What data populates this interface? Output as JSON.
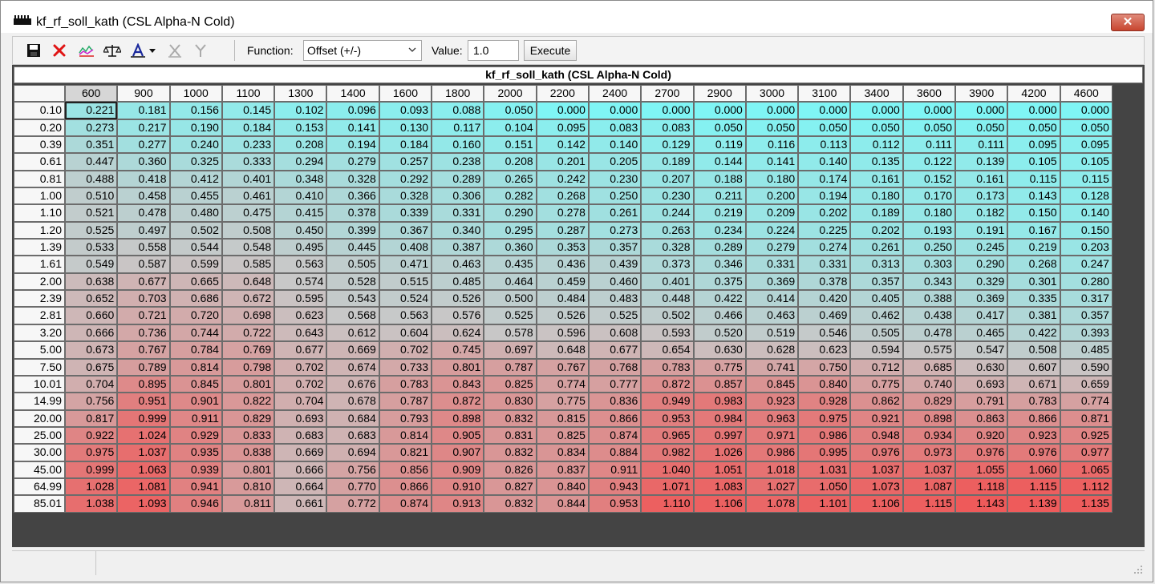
{
  "window": {
    "title": "kf_rf_soll_kath (CSL Alpha-N Cold)",
    "close_label": "✕"
  },
  "toolbar": {
    "function_label": "Function:",
    "function_value": "Offset (+/-)",
    "value_label": "Value:",
    "value_value": "1.0",
    "execute_label": "Execute"
  },
  "map": {
    "title": "kf_rf_soll_kath (CSL Alpha-N Cold)",
    "columns": [
      "600",
      "900",
      "1000",
      "1100",
      "1300",
      "1400",
      "1600",
      "1800",
      "2000",
      "2200",
      "2400",
      "2700",
      "2900",
      "3000",
      "3100",
      "3400",
      "3600",
      "3900",
      "4200",
      "4600"
    ],
    "rows": [
      {
        "label": "0.10",
        "values": [
          "0.221",
          "0.181",
          "0.156",
          "0.145",
          "0.102",
          "0.096",
          "0.093",
          "0.088",
          "0.050",
          "0.000",
          "0.000",
          "0.000",
          "0.000",
          "0.000",
          "0.000",
          "0.000",
          "0.000",
          "0.000",
          "0.000",
          "0.000"
        ]
      },
      {
        "label": "0.20",
        "values": [
          "0.273",
          "0.217",
          "0.190",
          "0.184",
          "0.153",
          "0.141",
          "0.130",
          "0.117",
          "0.104",
          "0.095",
          "0.083",
          "0.083",
          "0.050",
          "0.050",
          "0.050",
          "0.050",
          "0.050",
          "0.050",
          "0.050",
          "0.050"
        ]
      },
      {
        "label": "0.39",
        "values": [
          "0.351",
          "0.277",
          "0.240",
          "0.233",
          "0.208",
          "0.194",
          "0.184",
          "0.160",
          "0.151",
          "0.142",
          "0.140",
          "0.129",
          "0.119",
          "0.116",
          "0.113",
          "0.112",
          "0.111",
          "0.111",
          "0.095",
          "0.095"
        ]
      },
      {
        "label": "0.61",
        "values": [
          "0.447",
          "0.360",
          "0.325",
          "0.333",
          "0.294",
          "0.279",
          "0.257",
          "0.238",
          "0.208",
          "0.201",
          "0.205",
          "0.189",
          "0.144",
          "0.141",
          "0.140",
          "0.135",
          "0.122",
          "0.139",
          "0.105",
          "0.105"
        ]
      },
      {
        "label": "0.81",
        "values": [
          "0.488",
          "0.418",
          "0.412",
          "0.401",
          "0.348",
          "0.328",
          "0.292",
          "0.289",
          "0.265",
          "0.242",
          "0.230",
          "0.207",
          "0.188",
          "0.180",
          "0.174",
          "0.161",
          "0.152",
          "0.161",
          "0.115",
          "0.115"
        ]
      },
      {
        "label": "1.00",
        "values": [
          "0.510",
          "0.458",
          "0.455",
          "0.461",
          "0.410",
          "0.366",
          "0.328",
          "0.306",
          "0.282",
          "0.268",
          "0.250",
          "0.230",
          "0.211",
          "0.200",
          "0.194",
          "0.180",
          "0.170",
          "0.173",
          "0.143",
          "0.128"
        ]
      },
      {
        "label": "1.10",
        "values": [
          "0.521",
          "0.478",
          "0.480",
          "0.475",
          "0.415",
          "0.378",
          "0.339",
          "0.331",
          "0.290",
          "0.278",
          "0.261",
          "0.244",
          "0.219",
          "0.209",
          "0.202",
          "0.189",
          "0.180",
          "0.182",
          "0.150",
          "0.140"
        ]
      },
      {
        "label": "1.20",
        "values": [
          "0.525",
          "0.497",
          "0.502",
          "0.508",
          "0.450",
          "0.399",
          "0.367",
          "0.340",
          "0.295",
          "0.287",
          "0.273",
          "0.263",
          "0.234",
          "0.224",
          "0.225",
          "0.202",
          "0.193",
          "0.191",
          "0.167",
          "0.150"
        ]
      },
      {
        "label": "1.39",
        "values": [
          "0.533",
          "0.558",
          "0.544",
          "0.548",
          "0.495",
          "0.445",
          "0.408",
          "0.387",
          "0.360",
          "0.353",
          "0.357",
          "0.328",
          "0.289",
          "0.279",
          "0.274",
          "0.261",
          "0.250",
          "0.245",
          "0.219",
          "0.203"
        ]
      },
      {
        "label": "1.61",
        "values": [
          "0.549",
          "0.587",
          "0.599",
          "0.585",
          "0.563",
          "0.505",
          "0.471",
          "0.463",
          "0.435",
          "0.436",
          "0.439",
          "0.373",
          "0.346",
          "0.331",
          "0.331",
          "0.313",
          "0.303",
          "0.290",
          "0.268",
          "0.247"
        ]
      },
      {
        "label": "2.00",
        "values": [
          "0.638",
          "0.677",
          "0.665",
          "0.648",
          "0.574",
          "0.528",
          "0.515",
          "0.485",
          "0.464",
          "0.459",
          "0.460",
          "0.401",
          "0.375",
          "0.369",
          "0.378",
          "0.357",
          "0.343",
          "0.329",
          "0.301",
          "0.280"
        ]
      },
      {
        "label": "2.39",
        "values": [
          "0.652",
          "0.703",
          "0.686",
          "0.672",
          "0.595",
          "0.543",
          "0.524",
          "0.526",
          "0.500",
          "0.484",
          "0.483",
          "0.448",
          "0.422",
          "0.414",
          "0.420",
          "0.405",
          "0.388",
          "0.369",
          "0.335",
          "0.317"
        ]
      },
      {
        "label": "2.81",
        "values": [
          "0.660",
          "0.721",
          "0.720",
          "0.698",
          "0.623",
          "0.568",
          "0.563",
          "0.576",
          "0.525",
          "0.526",
          "0.525",
          "0.502",
          "0.466",
          "0.463",
          "0.469",
          "0.462",
          "0.438",
          "0.417",
          "0.381",
          "0.357"
        ]
      },
      {
        "label": "3.20",
        "values": [
          "0.666",
          "0.736",
          "0.744",
          "0.722",
          "0.643",
          "0.612",
          "0.604",
          "0.624",
          "0.578",
          "0.596",
          "0.608",
          "0.593",
          "0.520",
          "0.519",
          "0.546",
          "0.505",
          "0.478",
          "0.465",
          "0.422",
          "0.393"
        ]
      },
      {
        "label": "5.00",
        "values": [
          "0.673",
          "0.767",
          "0.784",
          "0.769",
          "0.677",
          "0.669",
          "0.702",
          "0.745",
          "0.697",
          "0.648",
          "0.677",
          "0.654",
          "0.630",
          "0.628",
          "0.623",
          "0.594",
          "0.575",
          "0.547",
          "0.508",
          "0.485"
        ]
      },
      {
        "label": "7.50",
        "values": [
          "0.675",
          "0.789",
          "0.814",
          "0.798",
          "0.702",
          "0.674",
          "0.733",
          "0.801",
          "0.787",
          "0.767",
          "0.768",
          "0.783",
          "0.775",
          "0.741",
          "0.750",
          "0.712",
          "0.685",
          "0.630",
          "0.607",
          "0.590"
        ]
      },
      {
        "label": "10.01",
        "values": [
          "0.704",
          "0.895",
          "0.845",
          "0.801",
          "0.702",
          "0.676",
          "0.783",
          "0.843",
          "0.825",
          "0.774",
          "0.777",
          "0.872",
          "0.857",
          "0.845",
          "0.840",
          "0.775",
          "0.740",
          "0.693",
          "0.671",
          "0.659"
        ]
      },
      {
        "label": "14.99",
        "values": [
          "0.756",
          "0.951",
          "0.901",
          "0.822",
          "0.704",
          "0.678",
          "0.787",
          "0.872",
          "0.830",
          "0.775",
          "0.836",
          "0.949",
          "0.983",
          "0.923",
          "0.928",
          "0.862",
          "0.829",
          "0.791",
          "0.783",
          "0.774"
        ]
      },
      {
        "label": "20.00",
        "values": [
          "0.817",
          "0.999",
          "0.911",
          "0.829",
          "0.693",
          "0.684",
          "0.793",
          "0.898",
          "0.832",
          "0.815",
          "0.866",
          "0.953",
          "0.984",
          "0.963",
          "0.975",
          "0.921",
          "0.898",
          "0.863",
          "0.866",
          "0.871"
        ]
      },
      {
        "label": "25.00",
        "values": [
          "0.922",
          "1.024",
          "0.929",
          "0.833",
          "0.683",
          "0.683",
          "0.814",
          "0.905",
          "0.831",
          "0.825",
          "0.874",
          "0.965",
          "0.997",
          "0.971",
          "0.986",
          "0.948",
          "0.934",
          "0.920",
          "0.923",
          "0.925"
        ]
      },
      {
        "label": "30.00",
        "values": [
          "0.975",
          "1.037",
          "0.935",
          "0.838",
          "0.669",
          "0.694",
          "0.821",
          "0.907",
          "0.832",
          "0.834",
          "0.884",
          "0.982",
          "1.026",
          "0.986",
          "0.995",
          "0.976",
          "0.973",
          "0.976",
          "0.976",
          "0.977"
        ]
      },
      {
        "label": "45.00",
        "values": [
          "0.999",
          "1.063",
          "0.939",
          "0.801",
          "0.666",
          "0.756",
          "0.856",
          "0.909",
          "0.826",
          "0.837",
          "0.911",
          "1.040",
          "1.051",
          "1.018",
          "1.031",
          "1.037",
          "1.037",
          "1.055",
          "1.060",
          "1.065"
        ]
      },
      {
        "label": "64.99",
        "values": [
          "1.028",
          "1.081",
          "0.941",
          "0.810",
          "0.664",
          "0.770",
          "0.866",
          "0.910",
          "0.827",
          "0.840",
          "0.943",
          "1.071",
          "1.083",
          "1.027",
          "1.050",
          "1.073",
          "1.087",
          "1.118",
          "1.115",
          "1.112"
        ]
      },
      {
        "label": "85.01",
        "values": [
          "1.038",
          "1.093",
          "0.946",
          "0.811",
          "0.661",
          "0.772",
          "0.874",
          "0.913",
          "0.832",
          "0.844",
          "0.953",
          "1.110",
          "1.106",
          "1.078",
          "1.101",
          "1.106",
          "1.115",
          "1.143",
          "1.139",
          "1.135"
        ]
      }
    ]
  },
  "colors": {
    "low": "#7ff5f5",
    "mid": "#c8c8c8",
    "high": "#ee5a5a"
  },
  "icons": [
    "save-icon",
    "delete-icon",
    "graph-icon",
    "balance-icon",
    "text-tool-icon",
    "cut-axis-icon",
    "merge-icon"
  ]
}
